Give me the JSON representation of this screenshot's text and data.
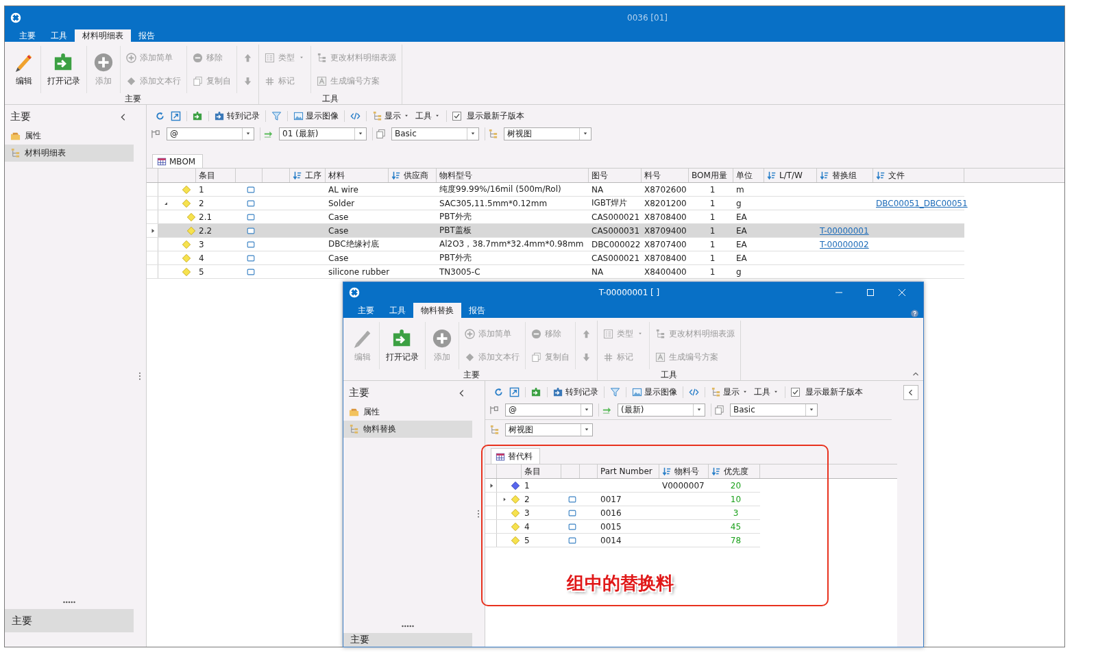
{
  "main_window": {
    "kind": "main",
    "title": "0036 [01]",
    "tabs": [
      {
        "label": "主要",
        "selected": false
      },
      {
        "label": "工具",
        "selected": false
      },
      {
        "label": "材料明细表",
        "selected": true
      },
      {
        "label": "报告",
        "selected": false
      }
    ],
    "ribbon": [
      {
        "label": "主要",
        "columns": [
          {
            "kind": "large",
            "items": [
              {
                "label": "编辑",
                "kind": "edit",
                "disabled": false
              }
            ]
          },
          {
            "kind": "large",
            "items": [
              {
                "label": "打开记录",
                "kind": "open",
                "disabled": false
              }
            ]
          },
          {
            "kind": "large",
            "items": [
              {
                "label": "添加",
                "kind": "add",
                "disabled": true
              }
            ]
          },
          {
            "kind": "small",
            "items": [
              {
                "label": "添加简单",
                "kind": "add-simple",
                "disabled": true
              },
              {
                "label": "添加文本行",
                "kind": "add-text",
                "disabled": true
              }
            ]
          },
          {
            "kind": "small",
            "items": [
              {
                "label": "移除",
                "kind": "remove",
                "disabled": true
              },
              {
                "label": "复制自",
                "kind": "copy",
                "disabled": true
              }
            ]
          },
          {
            "kind": "small",
            "items": [
              {
                "kind": "up",
                "disabled": true
              },
              {
                "kind": "down",
                "disabled": true
              }
            ]
          }
        ]
      },
      {
        "label": "工具",
        "columns": [
          {
            "kind": "small",
            "items": [
              {
                "label": "类型",
                "kind": "list",
                "dropdown": true,
                "disabled": true
              },
              {
                "label": "标记",
                "kind": "hash",
                "disabled": true
              }
            ]
          },
          {
            "kind": "small",
            "items": [
              {
                "label": "更改材料明细表源",
                "kind": "tree",
                "disabled": true
              },
              {
                "label": "生成编号方案",
                "kind": "letter",
                "disabled": true
              }
            ]
          }
        ]
      }
    ],
    "sidebar": {
      "title": "主要",
      "items": [
        {
          "label": "属性",
          "kind": "properties",
          "selected": false
        },
        {
          "label": "材料明细表",
          "kind": "tree",
          "selected": true
        }
      ],
      "footer": "主要"
    },
    "toolbar": [
      {
        "items": [
          {
            "kind": "refresh"
          },
          {
            "kind": "jump"
          }
        ]
      },
      {
        "items": [
          {
            "kind": "open"
          }
        ]
      },
      {
        "items": [
          {
            "kind": "goto",
            "label": "转到记录"
          }
        ]
      },
      {
        "items": [
          {
            "kind": "filter"
          }
        ]
      },
      {
        "items": [
          {
            "kind": "image",
            "label": "显示图像"
          }
        ]
      },
      {
        "items": [
          {
            "kind": "code"
          }
        ]
      },
      {
        "items": [
          {
            "kind": "display",
            "label": "显示",
            "dropdown": true
          },
          {
            "kind": "tools",
            "label": "工具",
            "dropdown": true
          }
        ]
      },
      {
        "items": [
          {
            "kind": "checkbox",
            "label": "显示最新子版本",
            "checked": true
          }
        ]
      }
    ],
    "filters": [
      [
        {
          "kind": "pin",
          "value": "@"
        },
        {
          "kind": "version",
          "value": "01 (最新)"
        },
        {
          "kind": "copy",
          "value": "Basic"
        },
        {
          "kind": "tree",
          "value": "树视图"
        }
      ]
    ],
    "grid_tab": "MBOM",
    "columns": [
      {
        "sortable": false
      },
      {
        "label": "条目",
        "sortable": false
      },
      {
        "sortable": false
      },
      {
        "sortable": false
      },
      {
        "label": "工序",
        "sortable": true
      },
      {
        "label": "材料",
        "sortable": false
      },
      {
        "label": "供应商",
        "sortable": true
      },
      {
        "label": "物料型号",
        "sortable": false
      },
      {
        "label": "图号",
        "sortable": false
      },
      {
        "label": "料号",
        "sortable": false
      },
      {
        "label": "BOM用量",
        "sortable": false
      },
      {
        "label": "单位",
        "sortable": false
      },
      {
        "label": "L/T/W",
        "sortable": true
      },
      {
        "label": "替换组",
        "sortable": true
      },
      {
        "label": "文件",
        "sortable": true
      }
    ],
    "rows": [
      {
        "item": "1",
        "material": "AL wire",
        "model": "纯度99.99%/16mil (500m/Rol)",
        "drawing": "NA",
        "part_no": "X8702600",
        "qty": "1",
        "unit": "m",
        "selected": false,
        "current": false
      },
      {
        "item": "2",
        "material": "Solder",
        "model": "SAC305,11.5mm*0.12mm",
        "drawing": "IGBT焊片",
        "part_no": "X8201200",
        "qty": "1",
        "unit": "g",
        "file": "DBC00051_DBC00051",
        "selected": false,
        "current": false,
        "expanded": true,
        "children": [
          {
            "item": "2.1",
            "material": "Case",
            "model": "PBT外壳",
            "drawing": "CAS000021",
            "part_no": "X8708400",
            "qty": "1",
            "unit": "EA",
            "selected": false,
            "current": false
          },
          {
            "item": "2.2",
            "material": "Case",
            "model": "PBT盖板",
            "drawing": "CAS000031",
            "part_no": "X8709400",
            "qty": "1",
            "unit": "EA",
            "group": "T-00000001",
            "selected": true,
            "current": true
          }
        ]
      },
      {
        "item": "3",
        "material": "DBC绝缘衬底",
        "model": "Al2O3，38.7mm*32.4mm*0.98mm",
        "drawing": "DBC000022",
        "part_no": "X8707400",
        "qty": "1",
        "unit": "EA",
        "group": "T-00000002",
        "selected": false,
        "current": false
      },
      {
        "item": "4",
        "material": "Case",
        "model": "PBT外壳",
        "drawing": "CAS000021",
        "part_no": "X8708400",
        "qty": "1",
        "unit": "EA",
        "selected": false,
        "current": false
      },
      {
        "item": "5",
        "material": "silicone rubber",
        "model": "TN3005-C",
        "drawing": "NA",
        "part_no": "X8400400",
        "qty": "1",
        "unit": "g",
        "selected": false,
        "current": false
      }
    ]
  },
  "child_window": {
    "kind": "dialog",
    "title": "T-00000001 [ ]",
    "tabs": [
      {
        "label": "主要",
        "selected": false
      },
      {
        "label": "工具",
        "selected": false
      },
      {
        "label": "物料替换",
        "selected": true
      },
      {
        "label": "报告",
        "selected": false
      }
    ],
    "ribbon": [
      {
        "label": "主要",
        "columns": [
          {
            "kind": "large",
            "items": [
              {
                "label": "编辑",
                "kind": "edit",
                "disabled": true
              }
            ]
          },
          {
            "kind": "large",
            "items": [
              {
                "label": "打开记录",
                "kind": "open",
                "disabled": false
              }
            ]
          },
          {
            "kind": "large",
            "items": [
              {
                "label": "添加",
                "kind": "add",
                "disabled": true
              }
            ]
          },
          {
            "kind": "small",
            "items": [
              {
                "label": "添加简单",
                "kind": "add-simple",
                "disabled": true
              },
              {
                "label": "添加文本行",
                "kind": "add-text",
                "disabled": true
              }
            ]
          },
          {
            "kind": "small",
            "items": [
              {
                "label": "移除",
                "kind": "remove",
                "disabled": true
              },
              {
                "label": "复制自",
                "kind": "copy",
                "disabled": true
              }
            ]
          },
          {
            "kind": "small",
            "items": [
              {
                "kind": "up",
                "disabled": true
              },
              {
                "kind": "down",
                "disabled": true
              }
            ]
          }
        ]
      },
      {
        "label": "工具",
        "columns": [
          {
            "kind": "small",
            "items": [
              {
                "label": "类型",
                "kind": "list",
                "dropdown": true,
                "disabled": true
              },
              {
                "label": "标记",
                "kind": "hash",
                "disabled": true
              }
            ]
          },
          {
            "kind": "small",
            "items": [
              {
                "label": "更改材料明细表源",
                "kind": "tree",
                "disabled": true
              },
              {
                "label": "生成编号方案",
                "kind": "letter",
                "disabled": true
              }
            ]
          }
        ]
      }
    ],
    "sidebar": {
      "title": "主要",
      "items": [
        {
          "label": "属性",
          "kind": "properties",
          "selected": false
        },
        {
          "label": "物料替换",
          "kind": "tree",
          "selected": true
        }
      ],
      "footer": "主要"
    },
    "toolbar": [
      {
        "items": [
          {
            "kind": "refresh"
          },
          {
            "kind": "jump"
          }
        ]
      },
      {
        "items": [
          {
            "kind": "open"
          }
        ]
      },
      {
        "items": [
          {
            "kind": "goto",
            "label": "转到记录"
          }
        ]
      },
      {
        "items": [
          {
            "kind": "filter"
          }
        ]
      },
      {
        "items": [
          {
            "kind": "image",
            "label": "显示图像"
          }
        ]
      },
      {
        "items": [
          {
            "kind": "code"
          }
        ]
      },
      {
        "items": [
          {
            "kind": "display",
            "label": "显示",
            "dropdown": true
          },
          {
            "kind": "tools",
            "label": "工具",
            "dropdown": true
          }
        ]
      },
      {
        "items": [
          {
            "kind": "checkbox",
            "label": "显示最新子版本",
            "checked": true
          }
        ]
      }
    ],
    "filters": [
      [
        {
          "kind": "pin",
          "value": "@"
        },
        {
          "kind": "version",
          "value": "(最新)"
        },
        {
          "kind": "copy",
          "value": "Basic"
        }
      ],
      [
        {
          "kind": "tree",
          "value": "树视图"
        }
      ]
    ],
    "grid_tab": "替代料",
    "columns": [
      {
        "sortable": false
      },
      {
        "label": "条目",
        "sortable": false
      },
      {
        "sortable": false
      },
      {
        "sortable": false
      },
      {
        "label": "Part Number",
        "sortable": false
      },
      {
        "label": "物料号",
        "sortable": true
      },
      {
        "label": "优先度",
        "sortable": true
      }
    ],
    "rows": [
      {
        "item": "1",
        "kind": "assembly",
        "material_no": "V0000007",
        "priority": "20",
        "selected": false,
        "current": true
      },
      {
        "item": "2",
        "kind": "part",
        "part_number": "0017",
        "priority": "10",
        "selected": false,
        "current": false,
        "expanded": false
      },
      {
        "item": "3",
        "kind": "part",
        "part_number": "0016",
        "priority": "3",
        "selected": false,
        "current": false
      },
      {
        "item": "4",
        "kind": "part",
        "part_number": "0015",
        "priority": "45",
        "selected": false,
        "current": false
      },
      {
        "item": "5",
        "kind": "part",
        "part_number": "0014",
        "priority": "78",
        "selected": false,
        "current": false
      }
    ],
    "annotation": "组中的替换料"
  }
}
